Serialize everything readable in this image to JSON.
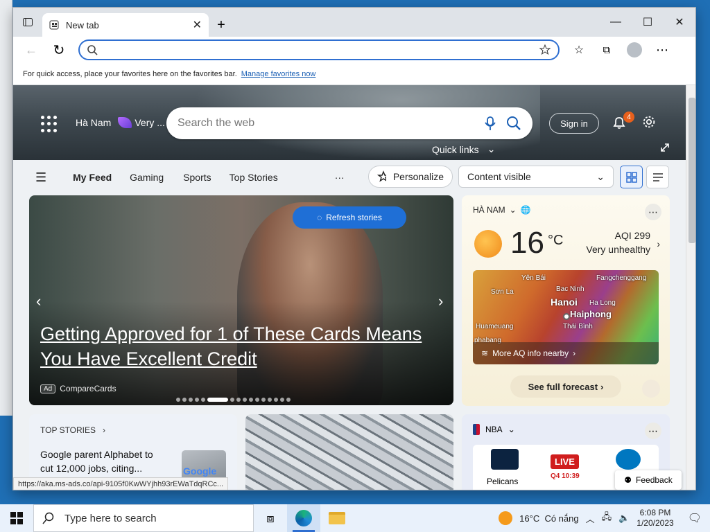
{
  "browser": {
    "tab_title": "New tab",
    "address_placeholder": "",
    "favbar_text": "For quick access, place your favorites here on the favorites bar.",
    "favbar_link": "Manage favorites now",
    "status_url": "https://aka.ms-ads.co/api-9105f0KwWYjhh93rEWaTdqRCc..."
  },
  "header": {
    "location": "Hà Nam",
    "weather_alert": "Very ...",
    "search_placeholder": "Search the web",
    "signin_label": "Sign in",
    "notification_count": "4",
    "quick_links_label": "Quick links"
  },
  "feed_nav": {
    "items": [
      "My Feed",
      "Gaming",
      "Sports",
      "Top Stories"
    ],
    "more": "···",
    "personalize_label": "Personalize",
    "content_visible_label": "Content visible"
  },
  "hero_story": {
    "refresh_label": "Refresh stories",
    "headline": "Getting Approved for 1 of These Cards Means You Have Excellent Credit",
    "ad_tag": "Ad",
    "sponsor": "CompareCards",
    "slide_count": 16,
    "active_slide": 5
  },
  "weather": {
    "location": "HÀ NAM",
    "temperature": "16",
    "unit": "°C",
    "aqi": "AQI 299",
    "aqi_status": "Very unhealthy",
    "map_labels": {
      "yen_bai": "Yên Bái",
      "fangchenggang": "Fangchenggang",
      "son_la": "Sơn La",
      "bac_ninh": "Bac Ninh",
      "hanoi": "Hanoi",
      "ha_long": "Ha Long",
      "haiphong": "Haiphong",
      "thai_binh": "Thái Bình",
      "huameuang": "Huameuang",
      "phabang": "phabang"
    },
    "map_footer": "More AQ info nearby",
    "forecast_label": "See full forecast"
  },
  "top_stories": {
    "header": "TOP STORIES",
    "story": "Google parent Alphabet to cut 12,000 jobs, citing...",
    "thumb_text": "Google"
  },
  "nba": {
    "header": "NBA",
    "team_home": "Pelicans",
    "live_label": "LIVE",
    "quarter": "Q4 10:39"
  },
  "feedback_label": "Feedback",
  "taskbar": {
    "search_placeholder": "Type here to search",
    "weather": "16°C  Có nắng",
    "time": "6:08 PM",
    "date": "1/20/2023"
  },
  "colors": {
    "accent": "#2f6fd1",
    "badge": "#e8601c",
    "live": "#d01d1d"
  }
}
